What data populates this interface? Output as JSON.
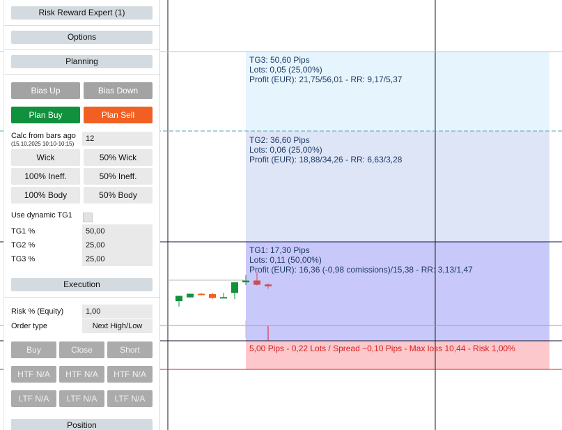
{
  "panel": {
    "title": "Risk Reward Expert (1)",
    "options_label": "Options",
    "planning_label": "Planning",
    "bias_up": "Bias Up",
    "bias_down": "Bias Down",
    "plan_buy": "Plan Buy",
    "plan_sell": "Plan Sell",
    "calc_label": "Calc from bars ago",
    "calc_sub": "(15.10.2025 10:10-10:15)",
    "calc_value": "12",
    "wick": "Wick",
    "wick50": "50% Wick",
    "ineff100": "100% Ineff.",
    "ineff50": "50% Ineff.",
    "body100": "100% Body",
    "body50": "50% Body",
    "dynamic_tg1_label": "Use dynamic TG1",
    "tg1_label": "TG1 %",
    "tg1_value": "50,00",
    "tg2_label": "TG2 %",
    "tg2_value": "25,00",
    "tg3_label": "TG3 %",
    "tg3_value": "25,00",
    "execution_label": "Execution",
    "risk_label": "Risk % (Equity)",
    "risk_value": "1,00",
    "order_type_label": "Order type",
    "order_type_value": "Next High/Low",
    "buy": "Buy",
    "close": "Close",
    "short": "Short",
    "htf1": "HTF N/A",
    "htf2": "HTF N/A",
    "htf3": "HTF N/A",
    "ltf1": "LTF N/A",
    "ltf2": "LTF N/A",
    "ltf3": "LTF N/A",
    "position_label": "Position"
  },
  "zones": {
    "tg3": {
      "line1": "TG3: 50,60 Pips",
      "line2": "Lots: 0,05 (25,00%)",
      "line3": "Profit (EUR): 21,75/56,01 - RR: 9,17/5,37"
    },
    "tg2": {
      "line1": "TG2: 36,60 Pips",
      "line2": "Lots: 0,06 (25,00%)",
      "line3": "Profit (EUR): 18,88/34,26 - RR: 6,63/3,28"
    },
    "tg1": {
      "line1": "TG1: 17,30 Pips",
      "line2": "Lots: 0,11 (50,00%)",
      "line3": "Profit (EUR): 16,36 (-0,98 comissions)/15,38 - RR: 3,13/1,47"
    },
    "risk": "5,00 Pips - 0,22 Lots / Spread ~0,10 Pips - Max loss 10,44 - Risk 1,00%"
  },
  "colors": {
    "tg3_zone": "#e6f4fd",
    "tg2_zone": "#dde5f6",
    "tg1_zone": "#c8c8fb",
    "risk_zone": "#fcc8cc",
    "bull_candle": "#11913d",
    "bear_candle": "#f25f22",
    "red_candle": "#d14b50",
    "sl_line": "#d62020",
    "entry_line": "#d39a3c"
  },
  "candles": [
    {
      "open": 1.163,
      "high": 1.16322,
      "low": 1.16221,
      "close": 1.16375,
      "color": "bull_candle"
    },
    {
      "open": 1.16353,
      "high": 1.16407,
      "low": 1.16353,
      "close": 1.16405,
      "color": "bull_candle"
    },
    {
      "open": 1.16405,
      "high": 1.16418,
      "low": 1.16395,
      "close": 1.16395,
      "color": "bear_candle"
    },
    {
      "open": 1.164,
      "high": 1.1642,
      "low": 1.1633,
      "close": 1.16344,
      "color": "bear_candle"
    },
    {
      "open": 1.16344,
      "high": 1.1642,
      "low": 1.16344,
      "close": 1.16357,
      "color": "bull_candle"
    },
    {
      "open": 1.16417,
      "high": 1.16569,
      "low": 1.16329,
      "close": 1.16569,
      "color": "bull_candle"
    },
    {
      "open": 1.16569,
      "high": 1.16672,
      "low": 1.1653,
      "close": 1.16594,
      "color": "bull_candle"
    },
    {
      "open": 1.16595,
      "high": 1.16715,
      "low": 1.16525,
      "close": 1.16534,
      "color": "red_candle"
    },
    {
      "open": 1.16538,
      "high": 1.16555,
      "low": 1.16478,
      "close": 1.16513,
      "color": "red_candle"
    }
  ]
}
